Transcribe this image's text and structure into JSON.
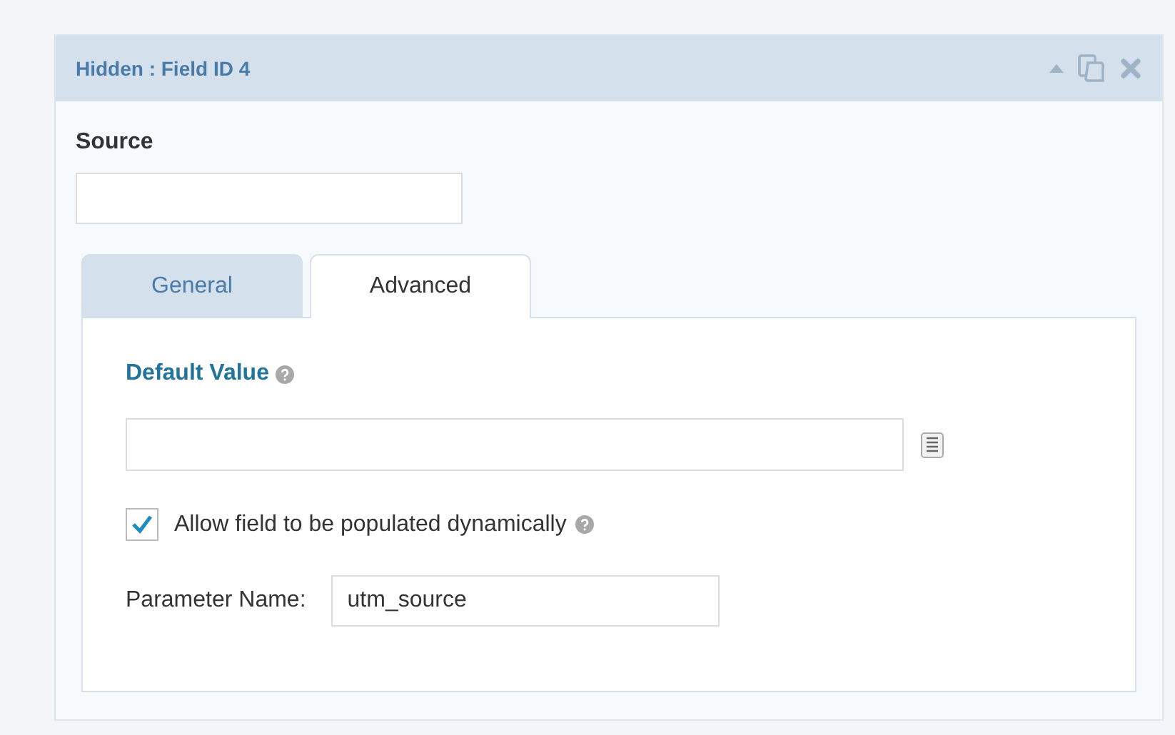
{
  "panel": {
    "title": "Hidden : Field ID 4"
  },
  "source": {
    "label": "Source"
  },
  "tabs": [
    {
      "label": "General",
      "selected": false
    },
    {
      "label": "Advanced",
      "selected": true
    }
  ],
  "advanced": {
    "default_value_label": "Default Value",
    "dynamic": {
      "label": "Allow field to be populated dynamically",
      "checked": true
    },
    "parameter": {
      "label": "Parameter Name:",
      "value": "utm_source"
    }
  }
}
